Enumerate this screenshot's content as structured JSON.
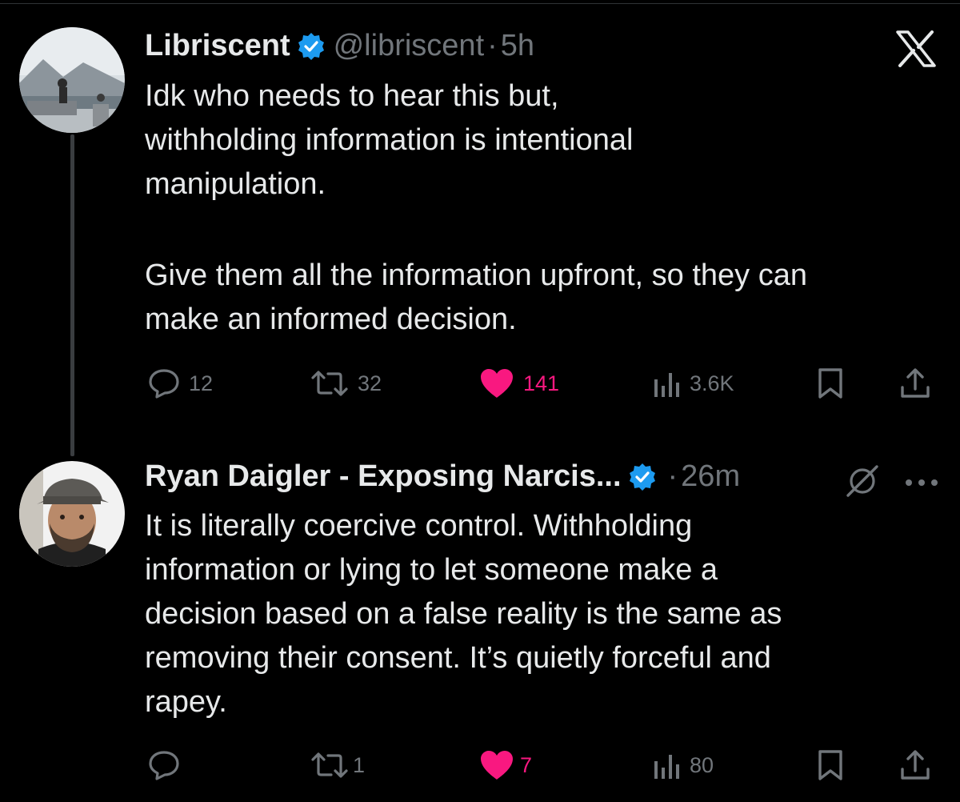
{
  "colors": {
    "background": "#000000",
    "text": "#e7e9ea",
    "muted": "#71767b",
    "like": "#f91880",
    "verified": "#1d9bf0"
  },
  "brand": {
    "logo_icon": "x-logo-icon"
  },
  "tweets": [
    {
      "author_name": "Libriscent",
      "handle": "@libriscent",
      "separator": "·",
      "time": "5h",
      "verified": true,
      "body": [
        "Idk who needs to hear this but,",
        "withholding information is intentional",
        "manipulation.",
        "",
        "Give them all the information upfront, so they can",
        "make an informed decision."
      ],
      "actions": {
        "replies": "12",
        "reposts": "32",
        "likes": "141",
        "views": "3.6K",
        "liked": true
      }
    },
    {
      "author_name": "Ryan Daigler - Exposing Narcis...",
      "separator": "·",
      "time": "26m",
      "verified": true,
      "body": [
        "It is literally coercive control. Withholding",
        "information or lying to let someone make a",
        "decision based on a false reality is the same as",
        "removing their consent. It’s quietly forceful and",
        "rapey."
      ],
      "actions": {
        "replies": "",
        "reposts": "1",
        "likes": "7",
        "views": "80",
        "liked": true
      }
    }
  ]
}
